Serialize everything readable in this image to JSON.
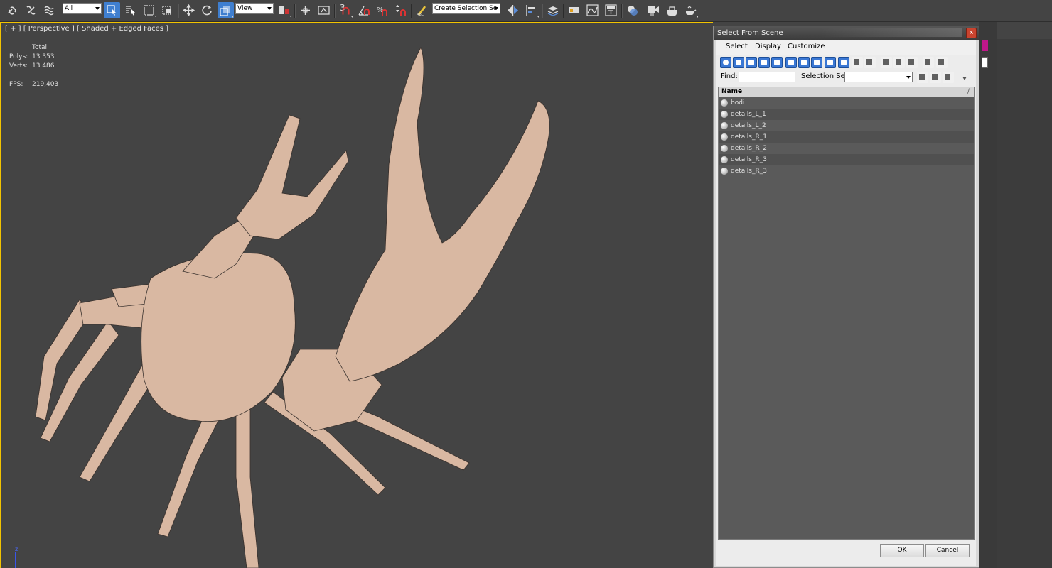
{
  "toolbar": {
    "filter_value": "All",
    "reference_coord": "View",
    "named_selection_placeholder": "Create Selection Se",
    "snap_label": "3",
    "icons": [
      "link-icon",
      "unlink-icon",
      "bind-spacewarp-icon",
      "select-object-icon",
      "select-by-name-icon",
      "rect-region-icon",
      "window-crossing-icon",
      "move-icon",
      "rotate-icon",
      "scale-icon",
      "pivot-center-icon",
      "select-manipulate-icon",
      "keyboard-shortcut-icon",
      "snaps-toggle-icon",
      "angle-snap-icon",
      "percent-snap-icon",
      "spinner-snap-icon",
      "edit-named-selection-icon",
      "mirror-icon",
      "align-icon",
      "layer-manager-icon",
      "ribbon-icon",
      "curve-editor-icon",
      "schematic-view-icon",
      "material-editor-icon",
      "render-setup-icon",
      "rendered-frame-icon",
      "render-icon"
    ]
  },
  "viewport": {
    "label": "[ + ] [ Perspective ] [ Shaded + Edged Faces ]",
    "stats_header": "Total",
    "stats": [
      {
        "key": "Polys:",
        "value": "13 353"
      },
      {
        "key": "Verts:",
        "value": "13 486"
      }
    ],
    "fps_key": "FPS:",
    "fps_value": "219,403",
    "axis_label": "z",
    "model_color": "#d9b8a2",
    "wire_color": "#3c3430"
  },
  "dialog": {
    "title": "Select From Scene",
    "close_glyph": "x",
    "menu": [
      "Select",
      "Display",
      "Customize"
    ],
    "find_label": "Find:",
    "find_value": "",
    "selection_set_label": "Selection Set:",
    "selection_set_value": "",
    "column_name": "Name",
    "column_sort_glyph": "/",
    "objects": [
      "bodi",
      "details_L_1",
      "details_L_2",
      "details_R_1",
      "details_R_2",
      "details_R_3",
      "details_R_3"
    ],
    "ok_label": "OK",
    "cancel_label": "Cancel"
  },
  "colors": {
    "viewport_bg": "#444444",
    "active_border": "#f2c300",
    "stats_text": "#ffd33a",
    "accent_blue": "#3b78d4",
    "pink_button": "#c0178a"
  }
}
